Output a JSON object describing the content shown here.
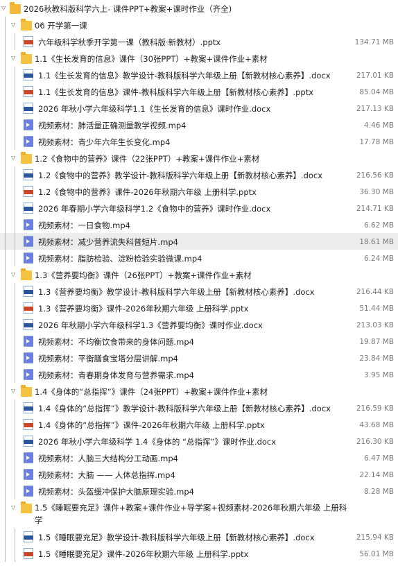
{
  "root": {
    "label": "2026秋教科版科学六上- 课件PPT+教案+课时作业（齐全)"
  },
  "nodes": [
    {
      "kind": "folder",
      "level": 1,
      "label": "06 开学第一课"
    },
    {
      "kind": "ppt",
      "level": 2,
      "label": "六年级科学秋季开学第一课（教科版·新教材）.pptx",
      "size": "134.71 MB"
    },
    {
      "kind": "folder",
      "level": 1,
      "label": "1.1《生长发育的信息》课件（30张PPT）+教案+课件作业+素材"
    },
    {
      "kind": "doc",
      "level": 2,
      "label": "1.1《生长发育的信息》教学设计-教科版科学六年级上册【新教材核心素养】.docx",
      "size": "217.01 KB"
    },
    {
      "kind": "ppt",
      "level": 2,
      "label": "1.1《生长发育的信息》课件-教科版科学六年级上册【新教材核心素养】.pptx",
      "size": "85.04 MB"
    },
    {
      "kind": "doc",
      "level": 2,
      "label": "2026 年秋小学六年级科学1.1《生长发育的信息》课时作业.docx",
      "size": "217.13 KB"
    },
    {
      "kind": "video",
      "level": 2,
      "label": "视频素材：肺活量正确测量教学视频.mp4",
      "size": "4.46 MB"
    },
    {
      "kind": "video",
      "level": 2,
      "label": "视频素材：青少年六年生长变化.mp4",
      "size": "17.78 MB"
    },
    {
      "kind": "folder",
      "level": 1,
      "label": "1.2《食物中的营养》课件（22张PPT）+教案+课件作业+素材"
    },
    {
      "kind": "doc",
      "level": 2,
      "label": "1.2《食物中的营养》教学设计-教科版科学六年级上册【新教材核心素养】.docx",
      "size": "216.56 KB"
    },
    {
      "kind": "ppt",
      "level": 2,
      "label": "1.2《食物中的营养》课件-2026年秋期六年级 上册科学.pptx",
      "size": "36.30 MB"
    },
    {
      "kind": "doc",
      "level": 2,
      "label": "2026 年春期小学六年级科学1.2《食物中的营养》课时作业.docx",
      "size": "214.71 KB"
    },
    {
      "kind": "video",
      "level": 2,
      "label": "视频素材：一日食物.mp4",
      "size": "6.62 MB"
    },
    {
      "kind": "video",
      "level": 2,
      "label": "视频素材：减少营养流失科普短片.mp4",
      "size": "18.61 MB",
      "selected": true
    },
    {
      "kind": "video",
      "level": 2,
      "label": "视频素材：脂肪检验、淀粉检验实验微课.mp4",
      "size": "6.24 MB"
    },
    {
      "kind": "folder",
      "level": 1,
      "label": "1.3《营养要均衡》课件（26张PPT）+教案+课件作业+素材"
    },
    {
      "kind": "doc",
      "level": 2,
      "label": "1.3《营养要均衡》教学设计-教科版科学六年级上册【新教材核心素养】.docx",
      "size": "216.44 KB"
    },
    {
      "kind": "ppt",
      "level": 2,
      "label": "1.3《营养要均衡》课件-2026年秋期六年级 上册科学.pptx",
      "size": "51.44 MB"
    },
    {
      "kind": "doc",
      "level": 2,
      "label": "2026 年秋期小学六年级科学1.3《营养要均衡》课时作业.docx",
      "size": "213.03 KB"
    },
    {
      "kind": "video",
      "level": 2,
      "label": "视频素材：不均衡饮食带来的身体问题.mp4",
      "size": "19.87 MB"
    },
    {
      "kind": "video",
      "level": 2,
      "label": "视频素材：平衡膳食宝塔分层讲解.mp4",
      "size": "23.84 MB"
    },
    {
      "kind": "video",
      "level": 2,
      "label": "视频素材：青春期身体发育与营养需求.mp4",
      "size": "3.95 MB"
    },
    {
      "kind": "folder",
      "level": 1,
      "label": "1.4《身体的“总指挥”》课件（24张PPT）+教案+课件作业+素材"
    },
    {
      "kind": "doc",
      "level": 2,
      "label": "1.4《身体的“总指挥”》教学设计-教科版科学六年级上册【新教材核心素养】.docx",
      "size": "216.59 KB"
    },
    {
      "kind": "ppt",
      "level": 2,
      "label": "1.4《身体的“总指挥”》课件-2026年秋期六年级 上册科学.pptx",
      "size": "43.68 MB"
    },
    {
      "kind": "doc",
      "level": 2,
      "label": "2026 年秋小学六年级科学 1.4《身体的 “总指挥”》课时作业.docx",
      "size": "216.30 KB"
    },
    {
      "kind": "video",
      "level": 2,
      "label": "视频素材：人脑三大结构分工动画.mp4",
      "size": "6.47 MB"
    },
    {
      "kind": "video",
      "level": 2,
      "label": "视频素材：大脑 —— 人体总指挥.mp4",
      "size": "22.14 MB"
    },
    {
      "kind": "video",
      "level": 2,
      "label": "视频素材：头盔缓冲保护大脑原理实验.mp4",
      "size": "8.28 MB"
    },
    {
      "kind": "folder",
      "level": 1,
      "tall": true,
      "label": "1.5《睡眠要充足》课件+教案+课件作业+导学案+视频素材-2026年秋期六年级 上册科学"
    },
    {
      "kind": "doc",
      "level": 2,
      "label": "1.5《睡眠要充足》教学设计-教科版科学六年级上册【新教材核心素养】.docx",
      "size": "215.94 KB"
    },
    {
      "kind": "ppt",
      "level": 2,
      "label": "1.5《睡眠要充足》课件-2026年秋期六年级 上册科学.pptx",
      "size": "56.01 MB"
    }
  ]
}
